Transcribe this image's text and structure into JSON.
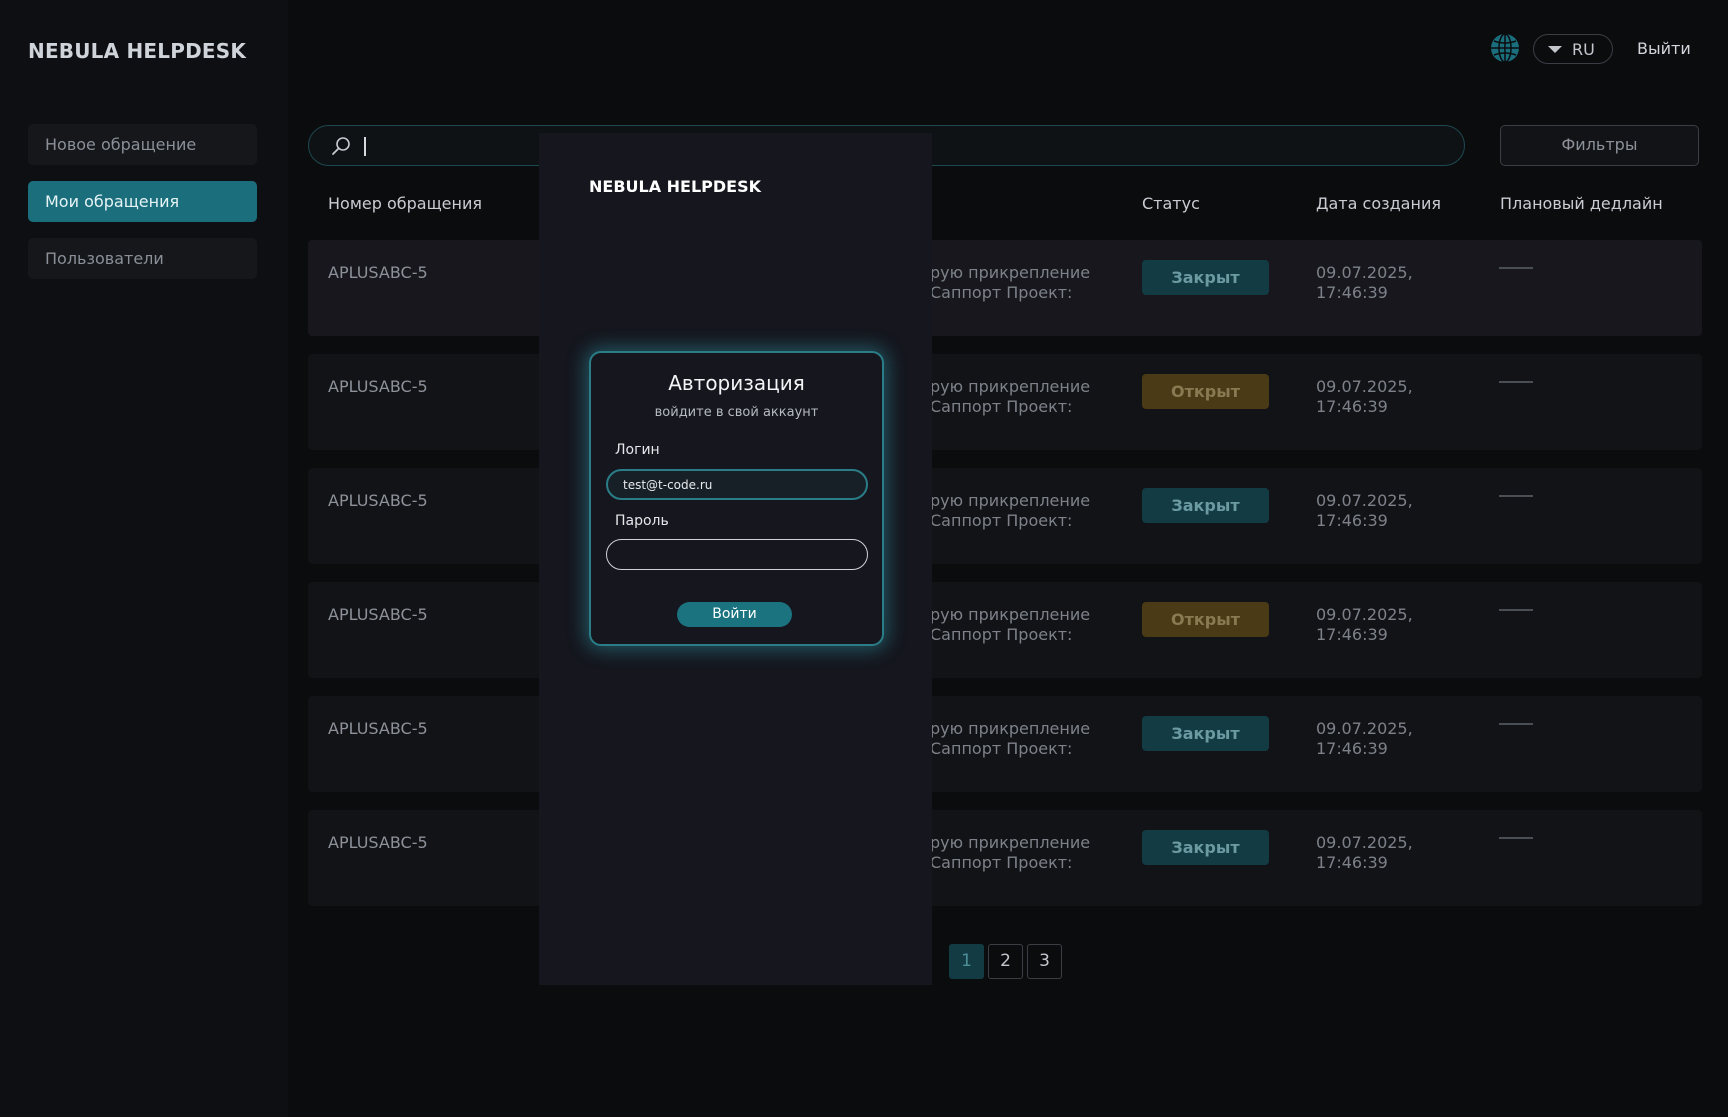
{
  "app": {
    "title": "NEBULA HELPDESK"
  },
  "sidebar": {
    "items": [
      {
        "label": "Новое обращение",
        "active": false
      },
      {
        "label": "Мои обращения",
        "active": true
      },
      {
        "label": "Пользователи",
        "active": false
      }
    ]
  },
  "header": {
    "language": "RU",
    "logout_label": "Выйти",
    "globe_icon": "globe-icon"
  },
  "search": {
    "value": "",
    "icon": "search-icon"
  },
  "filters_label": "Фильтры",
  "table": {
    "columns": [
      "Номер обращения",
      "Статус",
      "Дата создания",
      "Плановый дедлайн"
    ],
    "rows": [
      {
        "id": "APLUSABC-5",
        "desc_line1": "рую прикрепление",
        "desc_line2": "Саппорт Проект:",
        "status": "Закрыт",
        "date_line1": "09.07.2025,",
        "date_line2": "17:46:39",
        "deadline": "—"
      },
      {
        "id": "APLUSABC-5",
        "desc_line1": "рую прикрепление",
        "desc_line2": "Саппорт Проект:",
        "status": "Открыт",
        "date_line1": "09.07.2025,",
        "date_line2": "17:46:39",
        "deadline": "—"
      },
      {
        "id": "APLUSABC-5",
        "desc_line1": "рую прикрепление",
        "desc_line2": "Саппорт Проект:",
        "status": "Закрыт",
        "date_line1": "09.07.2025,",
        "date_line2": "17:46:39",
        "deadline": "—"
      },
      {
        "id": "APLUSABC-5",
        "desc_line1": "рую прикрепление",
        "desc_line2": "Саппорт Проект:",
        "status": "Открыт",
        "date_line1": "09.07.2025,",
        "date_line2": "17:46:39",
        "deadline": "—"
      },
      {
        "id": "APLUSABC-5",
        "desc_line1": "рую прикрепление",
        "desc_line2": "Саппорт Проект:",
        "status": "Закрыт",
        "date_line1": "09.07.2025,",
        "date_line2": "17:46:39",
        "deadline": "—"
      },
      {
        "id": "APLUSABC-5",
        "desc_line1": "рую прикрепление",
        "desc_line2": "Саппорт Проект:",
        "status": "Закрыт",
        "date_line1": "09.07.2025,",
        "date_line2": "17:46:39",
        "deadline": "—"
      }
    ]
  },
  "pagination": {
    "pages": [
      "1",
      "2",
      "3"
    ],
    "current": "1"
  },
  "colors": {
    "accent": "#1b7380",
    "closed_badge": "#133b44",
    "open_badge": "#4a3a16",
    "modal_glow": "#2a7d87"
  },
  "auth": {
    "panel_title": "NEBULA HELPDESK",
    "title": "Авторизация",
    "subtitle": "войдите в свой аккаунт",
    "login_label": "Логин",
    "login_value": "test@t-code.ru",
    "password_label": "Пароль",
    "password_value": "",
    "submit_label": "Войти"
  }
}
